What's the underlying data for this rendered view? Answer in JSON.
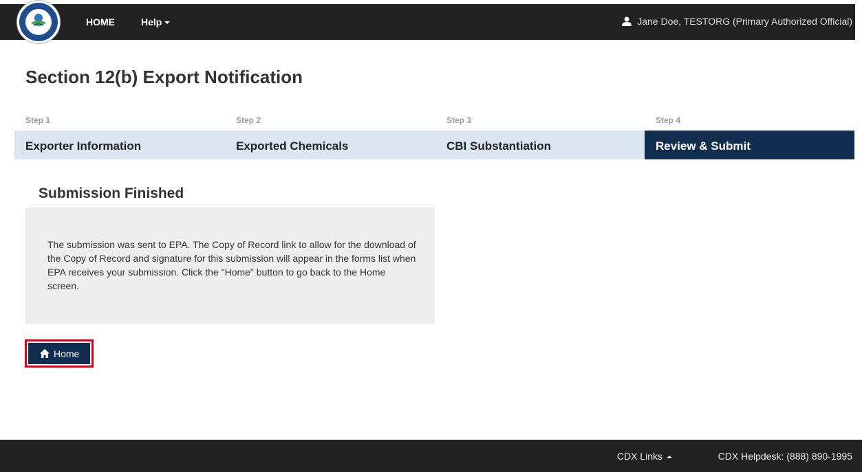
{
  "nav": {
    "home": "HOME",
    "help": "Help",
    "user": "Jane Doe, TESTORG (Primary Authorized Official)"
  },
  "page_title": "Section 12(b) Export Notification",
  "steps": [
    {
      "num": "Step 1",
      "label": "Exporter Information",
      "active": false
    },
    {
      "num": "Step 2",
      "label": "Exported Chemicals",
      "active": false
    },
    {
      "num": "Step 3",
      "label": "CBI Substantiation",
      "active": false
    },
    {
      "num": "Step 4",
      "label": "Review & Submit",
      "active": true
    }
  ],
  "section_heading": "Submission Finished",
  "message": "The submission was sent to EPA. The Copy of Record link to allow for the download of the Copy of Record and signature for this submission will appear in the forms list when EPA receives your submission. Click the \"Home\" button to go back to the Home screen.",
  "home_button": "Home",
  "footer": {
    "cdx_links": "CDX Links",
    "helpdesk": "CDX Helpdesk: (888) 890-1995"
  },
  "colors": {
    "navbar": "#222222",
    "step_inactive": "#dbe5f0",
    "step_active": "#112e51",
    "highlight": "#e0001b"
  }
}
